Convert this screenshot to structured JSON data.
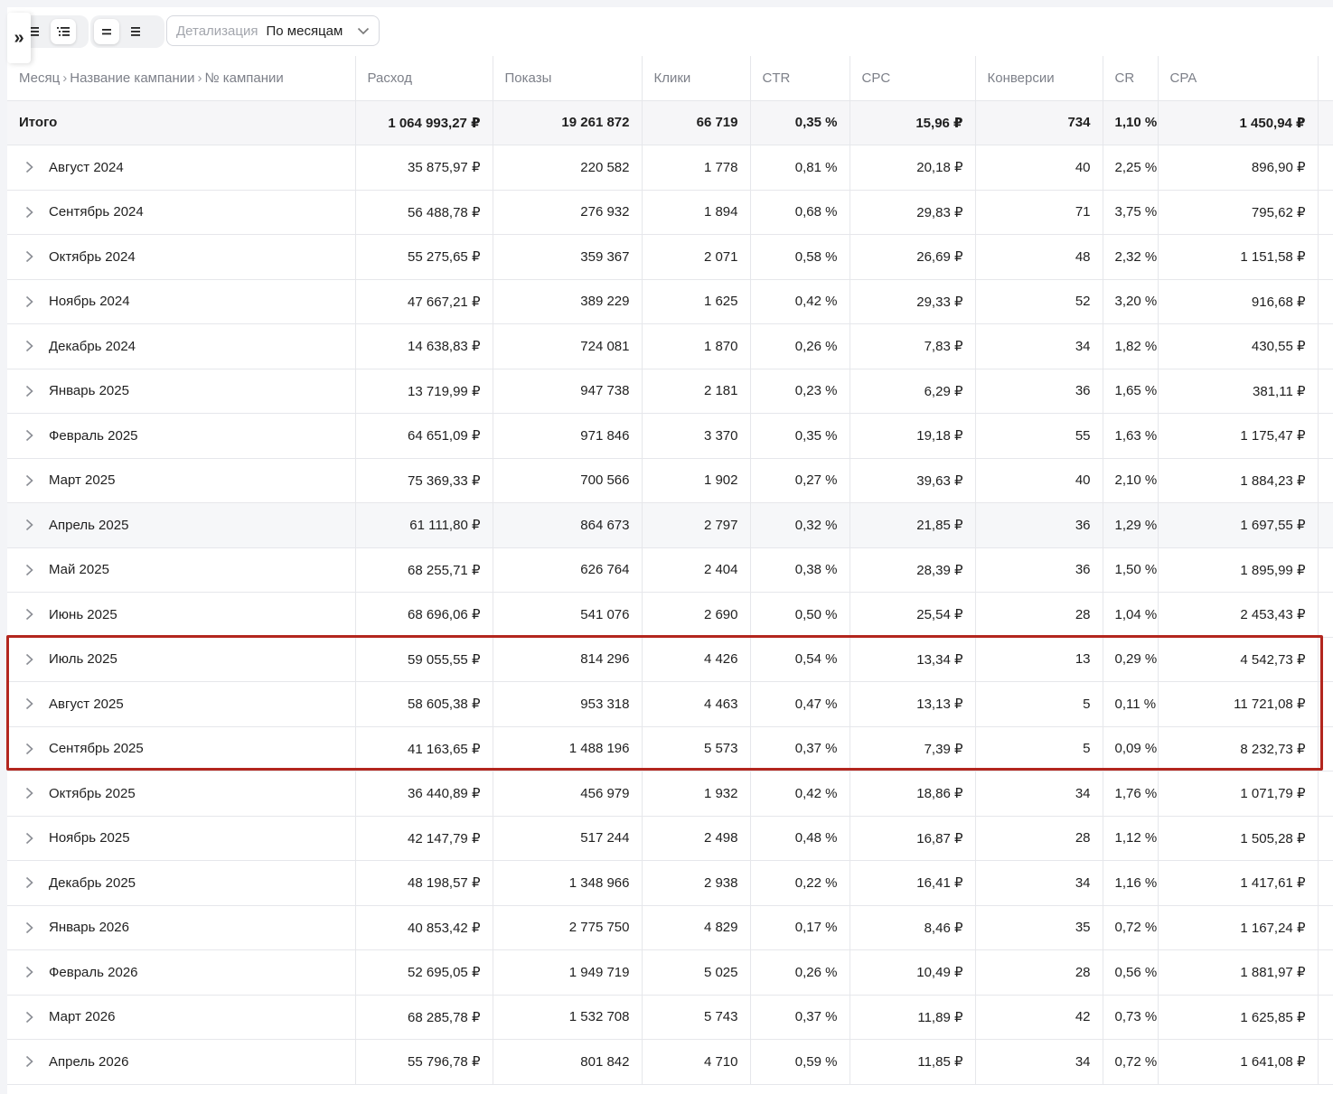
{
  "toolbar": {
    "expand_icon": "double-chevron-right-icon",
    "view_toggle_a": [
      "list-compact-icon",
      "list-detailed-icon"
    ],
    "view_toggle_b": [
      "density-compact-icon",
      "density-comfortable-icon"
    ],
    "detail_label": "Детализация",
    "detail_value": "По месяцам"
  },
  "table": {
    "breadcrumb": [
      "Месяц",
      "Название кампании",
      "№ кампании"
    ],
    "columns": [
      "Расход",
      "Показы",
      "Клики",
      "CTR",
      "CPC",
      "Конверсии",
      "CR",
      "CPA"
    ],
    "total": {
      "label": "Итого",
      "cells": [
        "1 064 993,27 ₽",
        "19 261 872",
        "66 719",
        "0,35 %",
        "15,96 ₽",
        "734",
        "1,10 %",
        "1 450,94 ₽"
      ]
    },
    "rows": [
      {
        "label": "Август 2024",
        "cells": [
          "35 875,97 ₽",
          "220 582",
          "1 778",
          "0,81 %",
          "20,18 ₽",
          "40",
          "2,25 %",
          "896,90 ₽"
        ]
      },
      {
        "label": "Сентябрь 2024",
        "cells": [
          "56 488,78 ₽",
          "276 932",
          "1 894",
          "0,68 %",
          "29,83 ₽",
          "71",
          "3,75 %",
          "795,62 ₽"
        ]
      },
      {
        "label": "Октябрь 2024",
        "cells": [
          "55 275,65 ₽",
          "359 367",
          "2 071",
          "0,58 %",
          "26,69 ₽",
          "48",
          "2,32 %",
          "1 151,58 ₽"
        ]
      },
      {
        "label": "Ноябрь 2024",
        "cells": [
          "47 667,21 ₽",
          "389 229",
          "1 625",
          "0,42 %",
          "29,33 ₽",
          "52",
          "3,20 %",
          "916,68 ₽"
        ]
      },
      {
        "label": "Декабрь 2024",
        "cells": [
          "14 638,83 ₽",
          "724 081",
          "1 870",
          "0,26 %",
          "7,83 ₽",
          "34",
          "1,82 %",
          "430,55 ₽"
        ]
      },
      {
        "label": "Январь 2025",
        "cells": [
          "13 719,99 ₽",
          "947 738",
          "2 181",
          "0,23 %",
          "6,29 ₽",
          "36",
          "1,65 %",
          "381,11 ₽"
        ]
      },
      {
        "label": "Февраль 2025",
        "cells": [
          "64 651,09 ₽",
          "971 846",
          "3 370",
          "0,35 %",
          "19,18 ₽",
          "55",
          "1,63 %",
          "1 175,47 ₽"
        ]
      },
      {
        "label": "Март 2025",
        "cells": [
          "75 369,33 ₽",
          "700 566",
          "1 902",
          "0,27 %",
          "39,63 ₽",
          "40",
          "2,10 %",
          "1 884,23 ₽"
        ]
      },
      {
        "label": "Апрель 2025",
        "cells": [
          "61 111,80 ₽",
          "864 673",
          "2 797",
          "0,32 %",
          "21,85 ₽",
          "36",
          "1,29 %",
          "1 697,55 ₽"
        ]
      },
      {
        "label": "Май 2025",
        "cells": [
          "68 255,71 ₽",
          "626 764",
          "2 404",
          "0,38 %",
          "28,39 ₽",
          "36",
          "1,50 %",
          "1 895,99 ₽"
        ]
      },
      {
        "label": "Июнь 2025",
        "cells": [
          "68 696,06 ₽",
          "541 076",
          "2 690",
          "0,50 %",
          "25,54 ₽",
          "28",
          "1,04 %",
          "2 453,43 ₽"
        ]
      },
      {
        "label": "Июль 2025",
        "cells": [
          "59 055,55 ₽",
          "814 296",
          "4 426",
          "0,54 %",
          "13,34 ₽",
          "13",
          "0,29 %",
          "4 542,73 ₽"
        ]
      },
      {
        "label": "Август 2025",
        "cells": [
          "58 605,38 ₽",
          "953 318",
          "4 463",
          "0,47 %",
          "13,13 ₽",
          "5",
          "0,11 %",
          "11 721,08 ₽"
        ]
      },
      {
        "label": "Сентябрь 2025",
        "cells": [
          "41 163,65 ₽",
          "1 488 196",
          "5 573",
          "0,37 %",
          "7,39 ₽",
          "5",
          "0,09 %",
          "8 232,73 ₽"
        ]
      },
      {
        "label": "Октябрь 2025",
        "cells": [
          "36 440,89 ₽",
          "456 979",
          "1 932",
          "0,42 %",
          "18,86 ₽",
          "34",
          "1,76 %",
          "1 071,79 ₽"
        ]
      },
      {
        "label": "Ноябрь 2025",
        "cells": [
          "42 147,79 ₽",
          "517 244",
          "2 498",
          "0,48 %",
          "16,87 ₽",
          "28",
          "1,12 %",
          "1 505,28 ₽"
        ]
      },
      {
        "label": "Декабрь 2025",
        "cells": [
          "48 198,57 ₽",
          "1 348 966",
          "2 938",
          "0,22 %",
          "16,41 ₽",
          "34",
          "1,16 %",
          "1 417,61 ₽"
        ]
      },
      {
        "label": "Январь 2026",
        "cells": [
          "40 853,42 ₽",
          "2 775 750",
          "4 829",
          "0,17 %",
          "8,46 ₽",
          "35",
          "0,72 %",
          "1 167,24 ₽"
        ]
      },
      {
        "label": "Февраль 2026",
        "cells": [
          "52 695,05 ₽",
          "1 949 719",
          "5 025",
          "0,26 %",
          "10,49 ₽",
          "28",
          "0,56 %",
          "1 881,97 ₽"
        ]
      },
      {
        "label": "Март 2026",
        "cells": [
          "68 285,78 ₽",
          "1 532 708",
          "5 743",
          "0,37 %",
          "11,89 ₽",
          "42",
          "0,73 %",
          "1 625,85 ₽"
        ]
      },
      {
        "label": "Апрель 2026",
        "cells": [
          "55 796,78 ₽",
          "801 842",
          "4 710",
          "0,59 %",
          "11,85 ₽",
          "34",
          "0,72 %",
          "1 641,08 ₽"
        ]
      }
    ],
    "hovered_row": "Апрель 2025",
    "highlighted_rows": [
      "Июль 2025",
      "Август 2025",
      "Сентябрь 2025"
    ],
    "highlight_color": "#b3261e"
  }
}
